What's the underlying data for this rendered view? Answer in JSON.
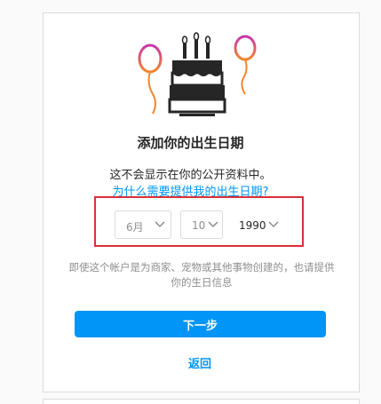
{
  "title": "添加你的出生日期",
  "description": "这不会显示在你的公开资料中。",
  "why_link": "为什么需要提供我的出生日期?",
  "birthday": {
    "month": "6月",
    "day": "10",
    "year": "1990"
  },
  "note": "即使这个帐户是为商家、宠物或其他事物创建的，也请提供你的生日信息",
  "next_button": "下一步",
  "back_link": "返回",
  "colors": {
    "accent": "#0095f6",
    "highlight": "#d9303a",
    "balloon_purple": "#c837ab",
    "balloon_orange": "#f58529"
  },
  "icons": {
    "illustration": "birthday-cake-balloons-icon",
    "dropdown": "chevron-down-icon"
  }
}
